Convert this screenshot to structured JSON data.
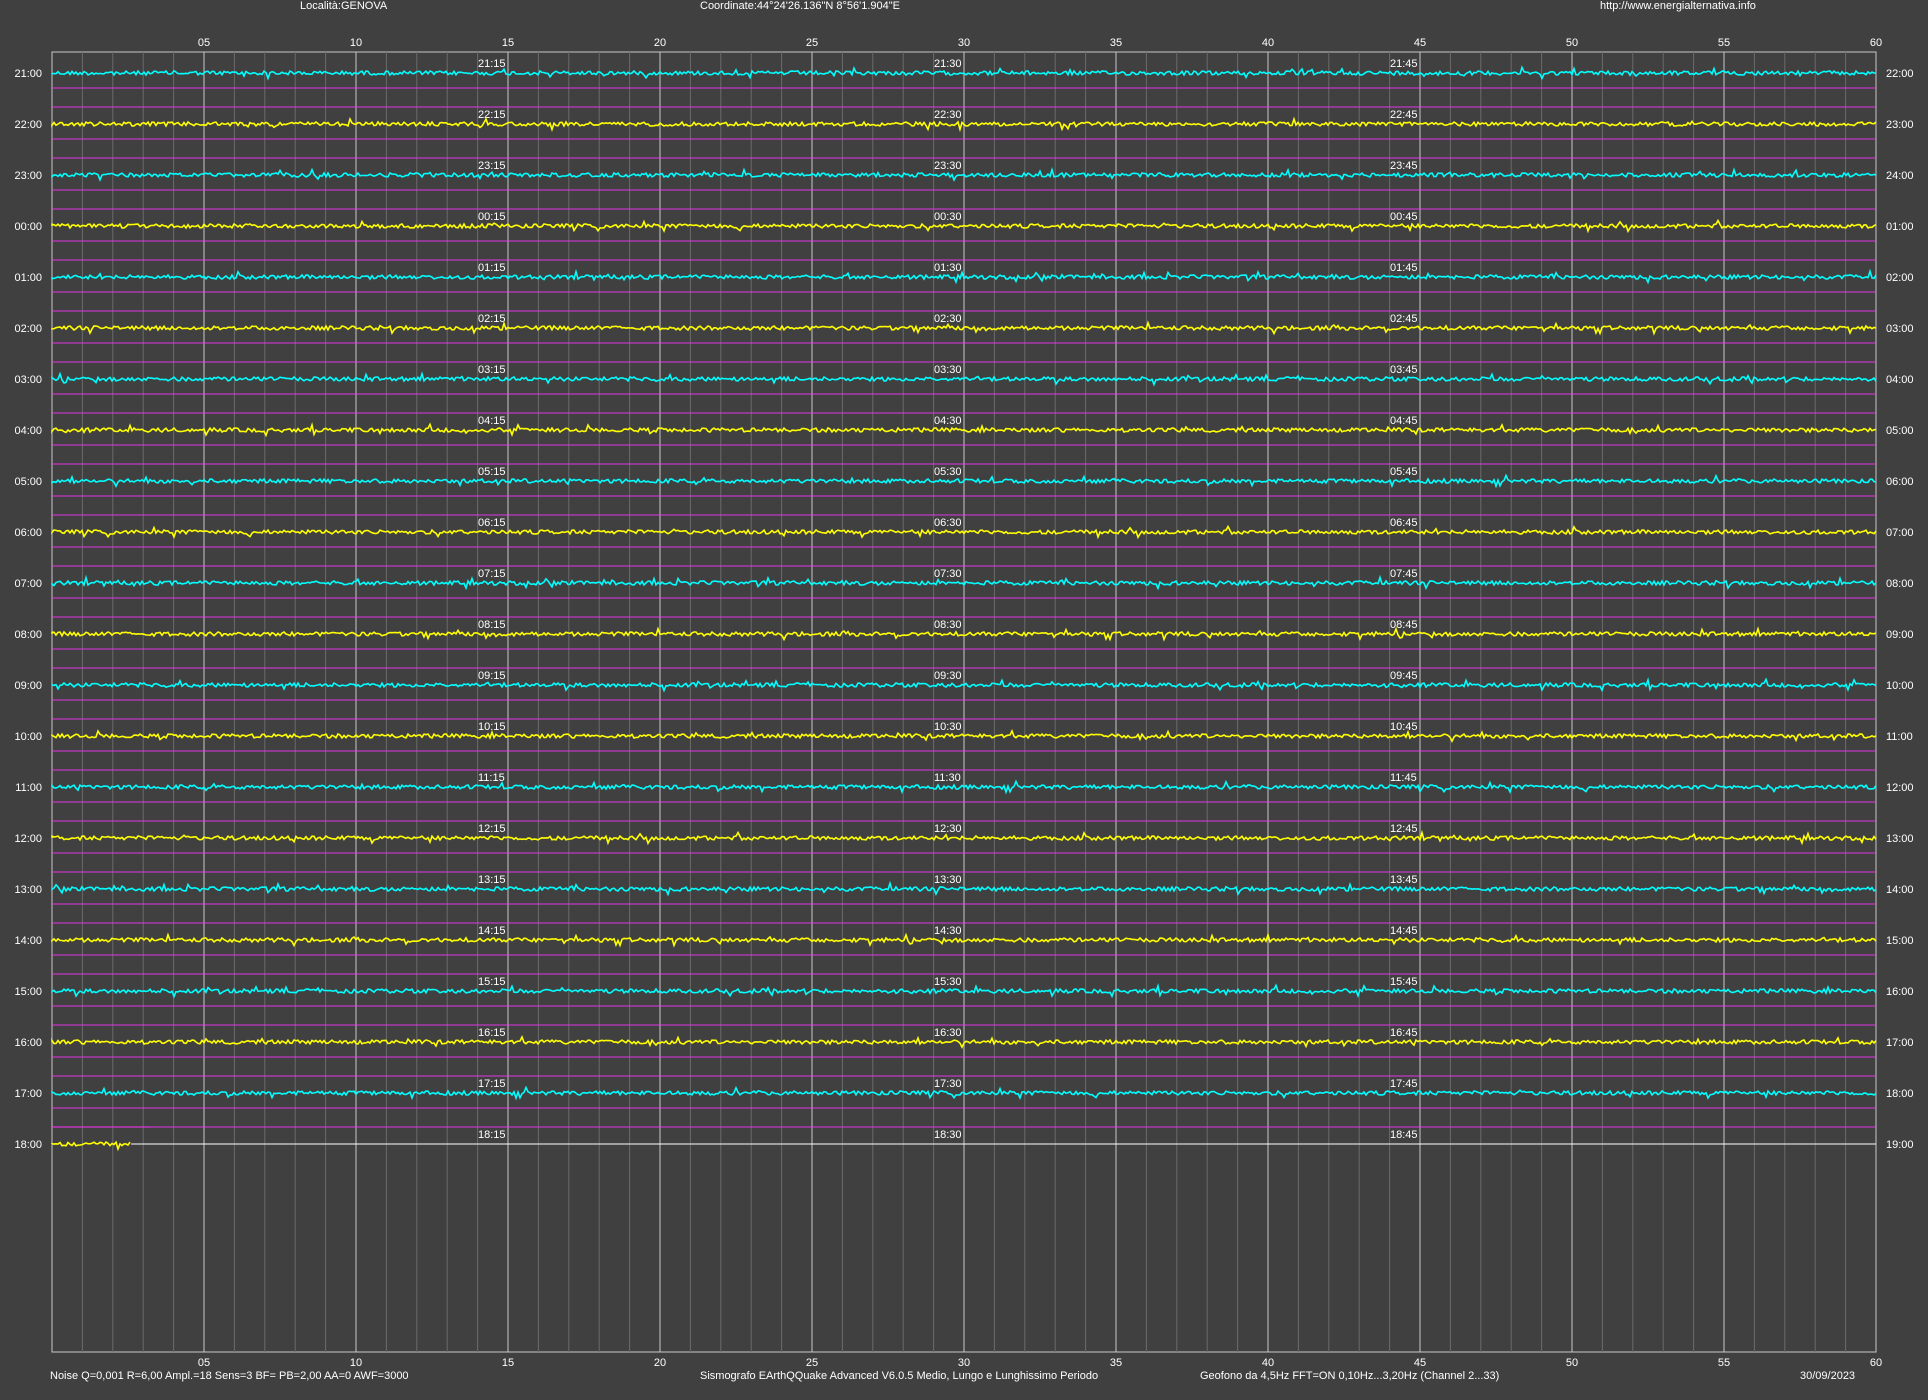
{
  "header": {
    "location": "Località:GENOVA",
    "coordinates": "Coordinate:44°24'26.136\"N  8°56'1.904\"E",
    "website": "http://www.energialternativa.info"
  },
  "footer": {
    "settings": "Noise Q=0,001 R=6,00 Ampl.=18 Sens=3 BF= PB=2,00 AA=0 AWF=3000",
    "software": "Sismografo  EArthQQuake Advanced V6.0.5  Medio, Lungo e Lunghissimo Periodo",
    "sensor": "Geofono da 4,5Hz FFT=ON 0,10Hz...3,20Hz     (Channel 2...33)",
    "date": "30/09/2023"
  },
  "x_ticks": [
    "05",
    "10",
    "15",
    "20",
    "25",
    "30",
    "35",
    "40",
    "45",
    "50",
    "55",
    "60"
  ],
  "left_hours": [
    "21:00",
    "22:00",
    "23:00",
    "00:00",
    "01:00",
    "02:00",
    "03:00",
    "04:00",
    "05:00",
    "06:00",
    "07:00",
    "08:00",
    "09:00",
    "10:00",
    "11:00",
    "12:00",
    "13:00",
    "14:00",
    "15:00",
    "16:00",
    "17:00",
    "18:00"
  ],
  "right_hours": [
    "22:00",
    "23:00",
    "24:00",
    "01:00",
    "02:00",
    "03:00",
    "04:00",
    "05:00",
    "06:00",
    "07:00",
    "08:00",
    "09:00",
    "10:00",
    "11:00",
    "12:00",
    "13:00",
    "14:00",
    "15:00",
    "16:00",
    "17:00",
    "18:00",
    "19:00"
  ],
  "quarter_labels": [
    [
      "21:15",
      "21:30",
      "21:45"
    ],
    [
      "22:15",
      "22:30",
      "22:45"
    ],
    [
      "23:15",
      "23:30",
      "23:45"
    ],
    [
      "00:15",
      "00:30",
      "00:45"
    ],
    [
      "01:15",
      "01:30",
      "01:45"
    ],
    [
      "02:15",
      "02:30",
      "02:45"
    ],
    [
      "03:15",
      "03:30",
      "03:45"
    ],
    [
      "04:15",
      "04:30",
      "04:45"
    ],
    [
      "05:15",
      "05:30",
      "05:45"
    ],
    [
      "06:15",
      "06:30",
      "06:45"
    ],
    [
      "07:15",
      "07:30",
      "07:45"
    ],
    [
      "08:15",
      "08:30",
      "08:45"
    ],
    [
      "09:15",
      "09:30",
      "09:45"
    ],
    [
      "10:15",
      "10:30",
      "10:45"
    ],
    [
      "11:15",
      "11:30",
      "11:45"
    ],
    [
      "12:15",
      "12:30",
      "12:45"
    ],
    [
      "13:15",
      "13:30",
      "13:45"
    ],
    [
      "14:15",
      "14:30",
      "14:45"
    ],
    [
      "15:15",
      "15:30",
      "15:45"
    ],
    [
      "16:15",
      "16:30",
      "16:45"
    ],
    [
      "17:15",
      "17:30",
      "17:45"
    ],
    [
      "18:15",
      "18:30",
      "18:45"
    ]
  ],
  "colors": {
    "background": "#404040",
    "grid_major": "#c8c8c8",
    "grid_minor": "#6a6a6a",
    "trace_odd": "#00ffff",
    "trace_even": "#ffff00",
    "long_period": "#ff33ff",
    "text": "#ffffff"
  },
  "last_trace_minutes": 2.6
}
